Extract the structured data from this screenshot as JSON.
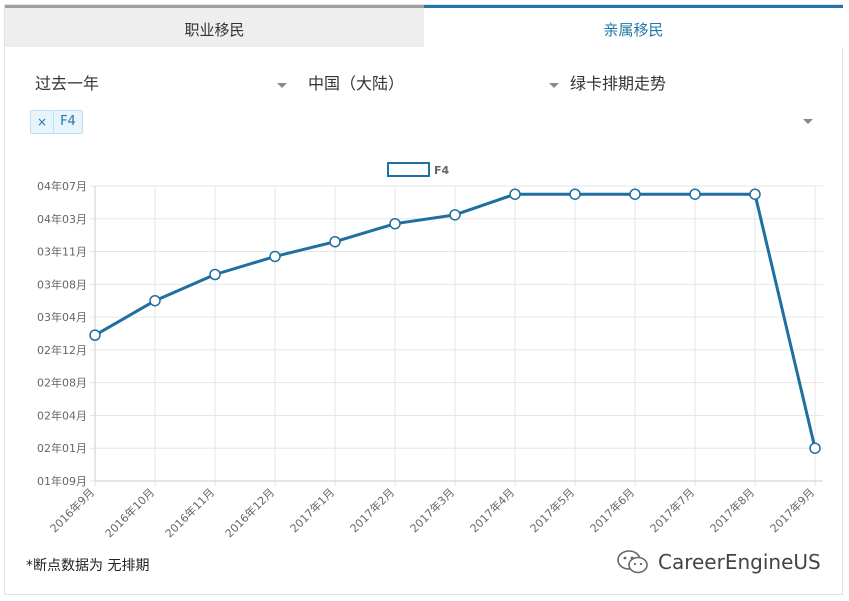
{
  "tabs": [
    {
      "label": "职业移民",
      "active": false
    },
    {
      "label": "亲属移民",
      "active": true
    }
  ],
  "filters": {
    "period": "过去一年",
    "country": "中国（大陆）",
    "chart_kind": "绿卡排期走势"
  },
  "selected_tag": {
    "remove": "×",
    "label": "F4"
  },
  "note": "*断点数据为 无排期",
  "watermark": "CareerEngineUS",
  "colors": {
    "series": "#1f6fa0",
    "active_tab": "#1f77a8",
    "grid": "#e6e6e6"
  },
  "chart_data": {
    "type": "line",
    "title": "",
    "xlabel": "",
    "ylabel": "",
    "legend": "top-center",
    "grid": true,
    "categories": [
      "2016年9月",
      "2016年10月",
      "2016年11月",
      "2016年12月",
      "2017年1月",
      "2017年2月",
      "2017年3月",
      "2017年4月",
      "2017年5月",
      "2017年6月",
      "2017年7月",
      "2017年8月",
      "2017年9月"
    ],
    "y_ticks": [
      "01年09月",
      "02年01月",
      "02年04月",
      "02年08月",
      "02年12月",
      "03年04月",
      "03年08月",
      "03年11月",
      "04年03月",
      "04年07月"
    ],
    "series": [
      {
        "name": "F4",
        "values": [
          4.45,
          5.5,
          6.3,
          6.85,
          7.3,
          7.85,
          8.12,
          8.75,
          8.75,
          8.75,
          8.75,
          8.75,
          1.0
        ]
      }
    ]
  }
}
